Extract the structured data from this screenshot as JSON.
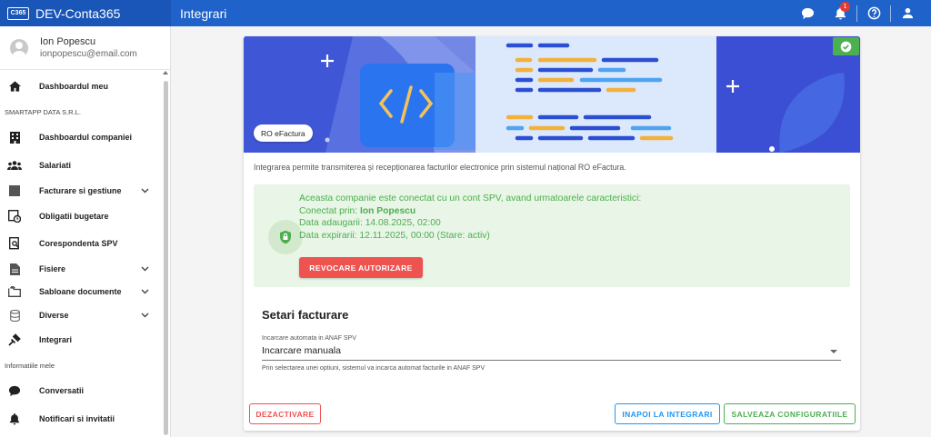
{
  "app": {
    "name": "DEV-Conta365",
    "logo_text": "C365"
  },
  "header": {
    "title": "Integrari",
    "notifications_count": "1",
    "icons": [
      "chat-icon",
      "bell-icon",
      "help-icon",
      "account-icon"
    ]
  },
  "user": {
    "name": "Ion Popescu",
    "email": "ionpopescu@email.com"
  },
  "sidebar": {
    "items": [
      {
        "label": "Dashboardul meu",
        "icon": "home-icon"
      },
      {
        "label": "Dashboardul companiei",
        "icon": "building-icon"
      },
      {
        "label": "Salariati",
        "icon": "people-icon"
      },
      {
        "label": "Facturare si gestiune",
        "icon": "square-icon"
      },
      {
        "label": "Obligatii bugetare",
        "icon": "budget-icon"
      },
      {
        "label": "Corespondenta SPV",
        "icon": "doc-search-icon"
      },
      {
        "label": "Fisiere",
        "icon": "file-icon"
      },
      {
        "label": "Sabloane documente",
        "icon": "folder-icon"
      },
      {
        "label": "Diverse",
        "icon": "database-icon"
      },
      {
        "label": "Integrari",
        "icon": "plug-icon"
      },
      {
        "label": "Conversatii",
        "icon": "chat-icon"
      },
      {
        "label": "Notificari si invitatii",
        "icon": "bell-icon"
      }
    ],
    "sections": {
      "company": "SMARTAPP DATA S.R.L.",
      "mine": "Informatiile mele"
    }
  },
  "integration": {
    "chip": "RO eFactura",
    "description": "Integrarea permite transmiterea și recepționarea facturilor electronice prin sistemul național RO eFactura.",
    "status": {
      "line1": "Aceasta companie este conectat cu un cont SPV, avand urmatoarele caracteristici:",
      "connected_label": "Conectat prin: ",
      "connected_name": "Ion Popescu",
      "added": "Data adaugarii: 14.08.2025, 02:00",
      "expires": "Data expirarii: 12.11.2025, 00:00 (Stare: activ)",
      "revoke_label": "REVOCARE AUTORIZARE"
    },
    "settings": {
      "title": "Setari facturare",
      "field_label": "Incarcare automata in ANAF SPV",
      "field_value": "Incarcare manuala",
      "field_help": "Prin selectarea unei optiuni, sistemul va incarca automat facturile in ANAF SPV"
    },
    "actions": {
      "deactivate": "DEZACTIVARE",
      "back": "INAPOI LA INTEGRARI",
      "save": "SALVEAZA CONFIGURATIILE"
    }
  },
  "colors": {
    "primary": "#1f62c9",
    "success": "#4caf50",
    "danger": "#ef5350",
    "info": "#2196f3",
    "status_bg": "#e9f5e6"
  }
}
